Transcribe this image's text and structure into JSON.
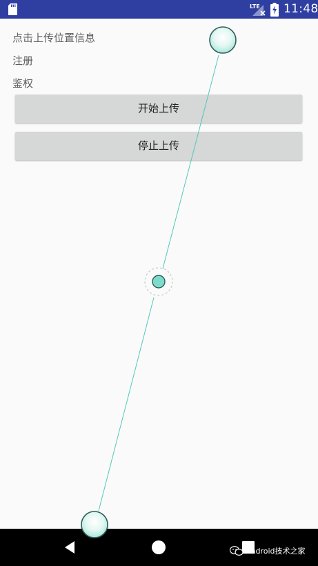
{
  "status_bar": {
    "network": "LTE",
    "time": "11:48",
    "background_color": "#2f3fa1",
    "icons": [
      "sd-card-icon",
      "lte-signal-icon",
      "battery-charging-icon"
    ]
  },
  "main": {
    "info_lines": [
      "点击上传位置信息",
      "注册",
      "鉴权"
    ],
    "buttons": {
      "start_upload": "开始上传",
      "stop_upload": "停止上传"
    }
  },
  "overlay": {
    "description_color": "#4fc9b8",
    "icons": [
      "touch-point-top-icon",
      "touch-midpoint-icon",
      "touch-point-bottom-icon"
    ]
  },
  "nav_bar": {
    "icons": [
      "back-icon",
      "home-icon",
      "recents-icon"
    ],
    "watermark": "Android技术之家"
  }
}
